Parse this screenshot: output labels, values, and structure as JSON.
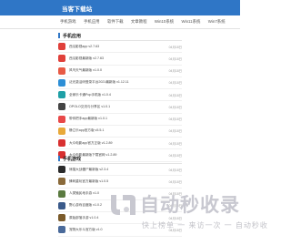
{
  "header": {
    "brand": "当客下载站"
  },
  "nav": {
    "items": [
      "手机游戏",
      "手机应用",
      "软件下载",
      "文章教程",
      "Win10系统",
      "Win11系统",
      "Win7系统"
    ]
  },
  "apps": {
    "title": "手机应用",
    "items": [
      {
        "name": "西瓜影视app v2.7.63",
        "date": "04月18日",
        "color": "#e0403a"
      },
      {
        "name": "西瓜影视最新版 v2.7.63",
        "date": "04月18日",
        "color": "#e0403a"
      },
      {
        "name": "风鸟天气最新版 v1.0.0",
        "date": "04月18日",
        "color": "#e85a44"
      },
      {
        "name": "泛光激活码登录平台2021最新版 v1.12.11",
        "date": "04月18日",
        "color": "#2d8fd6"
      },
      {
        "name": "全家乐卡通Pop手机版 v1.0.4",
        "date": "04月18日",
        "color": "#1fa0a6"
      },
      {
        "name": "OPOLO交流与分享区 v1.0.1",
        "date": "04月18日",
        "color": "#444444"
      },
      {
        "name": "带你把手app最新版 v1.0.1",
        "date": "04月18日",
        "color": "#e84848"
      },
      {
        "name": "静立乐app官方版 v5.5.1",
        "date": "04月18日",
        "color": "#e8a93a"
      },
      {
        "name": "大众电影app官方正版 v1.2.89",
        "date": "04月18日",
        "color": "#d83030"
      },
      {
        "name": "大众电影最新版下载官网 v1.2.89",
        "date": "04月18日",
        "color": "#d83030"
      }
    ]
  },
  "games": {
    "title": "手机游戏",
    "items": [
      {
        "name": "熊猫大战僵尸最新版 v2.3.4",
        "date": "04月18日",
        "color": "#2a2a2a"
      },
      {
        "name": "蜂刺重玩官方最新版 v1.0.5",
        "date": "04月18日",
        "color": "#8a6a3a"
      },
      {
        "name": "人类殖民地手游 v1.0",
        "date": "04月18日",
        "color": "#5a7a40"
      },
      {
        "name": "野心游戏百度版 v1.0.2",
        "date": "04月18日",
        "color": "#3a5a8a"
      },
      {
        "name": "原始部落手游 v1.0.4",
        "date": "04月18日",
        "color": "#7a5a2a"
      },
      {
        "name": "宠物大乐斗官方版 v1.0",
        "date": "04月18日",
        "color": "#4a6a9a"
      }
    ]
  },
  "watermark": {
    "title": "自动秒收录",
    "subtitle": "快上榜单 一 来访一次 一 自动秒收"
  }
}
